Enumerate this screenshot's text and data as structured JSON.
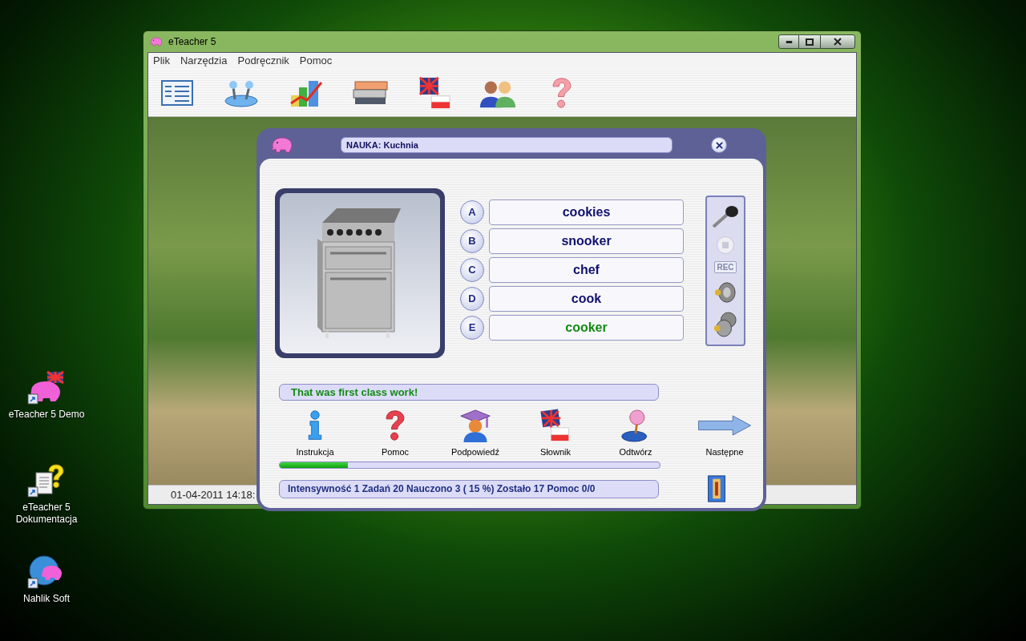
{
  "desktop_icons": [
    {
      "label": "eTeacher 5 Demo",
      "kind": "app"
    },
    {
      "label": "eTeacher 5 Dokumentacja",
      "kind": "doc"
    },
    {
      "label": "Nahlik Soft",
      "kind": "web"
    }
  ],
  "window": {
    "title": "eTeacher 5"
  },
  "menu": [
    "Plik",
    "Narzędzia",
    "Podręcznik",
    "Pomoc"
  ],
  "status_bar": {
    "datetime": "01-04-2011 14:18:"
  },
  "dialog": {
    "title": "NAUKA: Kuchnia",
    "answers": [
      {
        "letter": "A",
        "word": "cookies",
        "correct": false
      },
      {
        "letter": "B",
        "word": "snooker",
        "correct": false
      },
      {
        "letter": "C",
        "word": "chef",
        "correct": false
      },
      {
        "letter": "D",
        "word": "cook",
        "correct": false
      },
      {
        "letter": "E",
        "word": "cooker",
        "correct": true
      }
    ],
    "recorder": {
      "rec_label": "REC",
      "stop_disabled": true,
      "rec_disabled": true
    },
    "feedback": "That was first class work!",
    "tools": [
      {
        "label": "Instrukcja",
        "kind": "info"
      },
      {
        "label": "Pomoc",
        "kind": "help"
      },
      {
        "label": "Podpowiedź",
        "kind": "hint"
      },
      {
        "label": "Słownik",
        "kind": "dictionary"
      },
      {
        "label": "Odtwórz",
        "kind": "play"
      },
      {
        "label": "Następne",
        "kind": "next"
      }
    ],
    "progress": {
      "level": 0.18
    },
    "stats": "Intensywność 1 Zadań 20 Nauczono 3 ( 15 %) Zostało 17 Pomoc 0/0"
  }
}
